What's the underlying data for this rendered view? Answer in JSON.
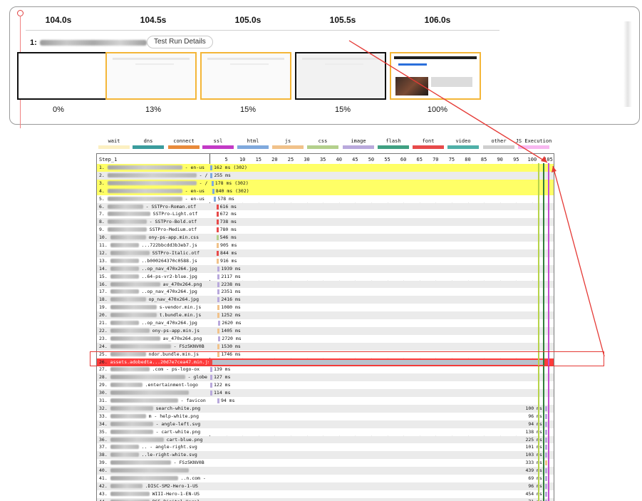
{
  "filmstrip": {
    "time_labels": [
      "104.0s",
      "104.5s",
      "105.0s",
      "105.5s",
      "106.0s"
    ],
    "step_label": "1:",
    "run_details_button": "Test Run Details",
    "frames": [
      {
        "percent": "0%",
        "border": "black"
      },
      {
        "percent": "13%",
        "border": "orange"
      },
      {
        "percent": "15%",
        "border": "orange"
      },
      {
        "percent": "15%",
        "border": "black"
      },
      {
        "percent": "100%",
        "border": "orange"
      }
    ]
  },
  "legend": [
    {
      "label": "wait",
      "color": "#fcf0c2"
    },
    {
      "label": "dns",
      "color": "#3a9c9d"
    },
    {
      "label": "connect",
      "color": "#e88a3a"
    },
    {
      "label": "ssl",
      "color": "#c33ac6"
    },
    {
      "label": "html",
      "color": "#7fa9dd"
    },
    {
      "label": "js",
      "color": "#f1c28a"
    },
    {
      "label": "css",
      "color": "#b4d08c"
    },
    {
      "label": "image",
      "color": "#b9a9dc"
    },
    {
      "label": "flash",
      "color": "#3fa082"
    },
    {
      "label": "font",
      "color": "#e74a4a"
    },
    {
      "label": "video",
      "color": "#4fb0a8"
    },
    {
      "label": "other",
      "color": "#cfcfcf"
    },
    {
      "label": "JS Execution",
      "color": "#f7b7f0"
    }
  ],
  "waterfall": {
    "step_name": "Step_1",
    "ticks": [
      "5",
      "10",
      "15",
      "20",
      "25",
      "30",
      "35",
      "40",
      "45",
      "50",
      "55",
      "60",
      "65",
      "70",
      "75",
      "80",
      "85",
      "90",
      "95",
      "100",
      "105"
    ],
    "rows": [
      {
        "num": "1.",
        "name": "- en-us",
        "time": "162 ms (302)",
        "start": 0.0,
        "highlight": "yellow",
        "color": "#7fa9dd"
      },
      {
        "num": "2.",
        "name": "- /",
        "time": "255 ms",
        "start": 0.1,
        "highlight": "",
        "color": "#7fa9dd"
      },
      {
        "num": "3.",
        "name": "- /",
        "time": "178 ms (302)",
        "start": 0.4,
        "highlight": "yellow",
        "color": "#7fa9dd"
      },
      {
        "num": "4.",
        "name": "- en-us",
        "time": "840 ms (302)",
        "start": 0.6,
        "highlight": "yellow",
        "color": "#7fa9dd"
      },
      {
        "num": "5.",
        "name": "- en-us",
        "time": "578 ms",
        "start": 1.2,
        "highlight": "",
        "color": "#7fa9dd"
      },
      {
        "num": "6.",
        "name": "- SSTPro-Roman.otf",
        "time": "616 ms",
        "start": 1.9,
        "highlight": "",
        "color": "#e74a4a"
      },
      {
        "num": "7.",
        "name": "SSTPro-Light.otf",
        "time": "672 ms",
        "start": 1.9,
        "highlight": "",
        "color": "#e74a4a"
      },
      {
        "num": "8.",
        "name": "- SSTPro-Bold.otf",
        "time": "738 ms",
        "start": 1.9,
        "highlight": "",
        "color": "#e74a4a"
      },
      {
        "num": "9.",
        "name": "SSTPro-Medium.otf",
        "time": "780 ms",
        "start": 1.9,
        "highlight": "",
        "color": "#e74a4a"
      },
      {
        "num": "10.",
        "name": "ony-ps-app.min.css",
        "time": "546 ms",
        "start": 1.9,
        "highlight": "",
        "color": "#b4d08c"
      },
      {
        "num": "11.",
        "name": "...722bbcdd3b3eb7.js",
        "time": "905 ms",
        "start": 2.0,
        "highlight": "",
        "color": "#f1c28a"
      },
      {
        "num": "12.",
        "name": "SSTPro-Italic.otf",
        "time": "844 ms",
        "start": 2.0,
        "highlight": "",
        "color": "#e74a4a"
      },
      {
        "num": "13.",
        "name": "..b000264370c0588.js",
        "time": "916 ms",
        "start": 2.0,
        "highlight": "",
        "color": "#f1c28a"
      },
      {
        "num": "14.",
        "name": "..op_nav_470x264.jpg",
        "time": "1939 ms",
        "start": 2.3,
        "highlight": "",
        "color": "#b9a9dc"
      },
      {
        "num": "15.",
        "name": "..64-ps-vr2-blue.jpg",
        "time": "2117 ms",
        "start": 2.3,
        "highlight": "",
        "color": "#b9a9dc"
      },
      {
        "num": "16.",
        "name": "av_470x264.png",
        "time": "2238 ms",
        "start": 2.3,
        "highlight": "",
        "color": "#b9a9dc"
      },
      {
        "num": "17.",
        "name": "..op_nav_470x264.jpg",
        "time": "2351 ms",
        "start": 2.3,
        "highlight": "",
        "color": "#b9a9dc"
      },
      {
        "num": "18.",
        "name": "op_nav_470x264.jpg",
        "time": "2416 ms",
        "start": 2.3,
        "highlight": "",
        "color": "#b9a9dc"
      },
      {
        "num": "19.",
        "name": "s-vendor.min.js",
        "time": "1080 ms",
        "start": 2.3,
        "highlight": "",
        "color": "#f1c28a"
      },
      {
        "num": "20.",
        "name": "t.bundle.min.js",
        "time": "1252 ms",
        "start": 2.3,
        "highlight": "",
        "color": "#f1c28a"
      },
      {
        "num": "21.",
        "name": "..op_nav_470x264.jpg",
        "time": "2620 ms",
        "start": 2.5,
        "highlight": "",
        "color": "#b9a9dc"
      },
      {
        "num": "22.",
        "name": "ony-ps-app.min.js",
        "time": "1405 ms",
        "start": 2.3,
        "highlight": "",
        "color": "#f1c28a"
      },
      {
        "num": "23.",
        "name": "av_470x264.png",
        "time": "2720 ms",
        "start": 2.5,
        "highlight": "",
        "color": "#b9a9dc"
      },
      {
        "num": "24.",
        "name": "- FSz5KNV0B",
        "time": "1530 ms",
        "start": 2.3,
        "highlight": "",
        "color": "#f1c28a"
      },
      {
        "num": "25.",
        "name": "ndor.bundle.min.js",
        "time": "1746 ms",
        "start": 2.3,
        "highlight": "",
        "color": "#f1c28a"
      },
      {
        "num": "26.",
        "name": "assets.adobedta...20d7e7cea47.min.js",
        "time": "",
        "start": 0.0,
        "highlight": "red",
        "color": "#e74a4a"
      },
      {
        "num": "27.",
        "name": ".com - ps-logo-ox",
        "time": "139 ms",
        "start": 0.0,
        "highlight": "",
        "color": "#b9a9dc"
      },
      {
        "num": "28.",
        "name": "- globe",
        "time": "127 ms",
        "start": 0.0,
        "highlight": "",
        "color": "#b9a9dc"
      },
      {
        "num": "29.",
        "name": ".entertainment-logo",
        "time": "122 ms",
        "start": 0.0,
        "highlight": "",
        "color": "#b9a9dc"
      },
      {
        "num": "30.",
        "name": "",
        "time": "114 ms",
        "start": 0.0,
        "highlight": "",
        "color": "#b9a9dc"
      },
      {
        "num": "31.",
        "name": "- favicon",
        "time": "94 ms",
        "start": 2.2,
        "highlight": "",
        "color": "#b9a9dc"
      },
      {
        "num": "32.",
        "name": "search-white.png",
        "time": "100 ms",
        "start": 104.0,
        "highlight": "",
        "color": "#b9a9dc"
      },
      {
        "num": "33.",
        "name": "m - help-white.png",
        "time": "96 ms",
        "start": 104.0,
        "highlight": "",
        "color": "#b9a9dc"
      },
      {
        "num": "34.",
        "name": "- angle-left.svg",
        "time": "94 ms",
        "start": 104.0,
        "highlight": "",
        "color": "#b9a9dc"
      },
      {
        "num": "35.",
        "name": "- cart-white.png",
        "time": "138 ms",
        "start": 104.0,
        "highlight": "",
        "color": "#b9a9dc"
      },
      {
        "num": "36.",
        "name": "cart-blue.png",
        "time": "225 ms",
        "start": 104.0,
        "highlight": "",
        "color": "#b9a9dc"
      },
      {
        "num": "37.",
        "name": ".. - angle-right.svg",
        "time": "101 ms",
        "start": 104.0,
        "highlight": "",
        "color": "#b9a9dc"
      },
      {
        "num": "38.",
        "name": "..le-right-white.svg",
        "time": "103 ms",
        "start": 104.0,
        "highlight": "",
        "color": "#b9a9dc"
      },
      {
        "num": "39.",
        "name": "- FSz5KNV0B",
        "time": "333 ms",
        "start": 104.0,
        "highlight": "",
        "color": "#f1c28a"
      },
      {
        "num": "40.",
        "name": "",
        "time": "439 ms",
        "start": 104.0,
        "highlight": "",
        "color": "#b9a9dc"
      },
      {
        "num": "41.",
        "name": "..n.com -",
        "time": "69 ms",
        "start": 104.0,
        "highlight": "",
        "color": "#b9a9dc"
      },
      {
        "num": "42.",
        "name": ".DISC-SM2-Hero-1-US",
        "time": "96 ms",
        "start": 104.0,
        "highlight": "",
        "color": "#b9a9dc"
      },
      {
        "num": "43.",
        "name": "WIII-Hero-1-EN-US",
        "time": "454 ms",
        "start": 104.0,
        "highlight": "",
        "color": "#b9a9dc"
      },
      {
        "num": "44.",
        "name": "PS5-Digital-Hero1",
        "time": "71 ms",
        "start": 104.0,
        "highlight": "",
        "color": "#b9a9dc"
      }
    ]
  }
}
